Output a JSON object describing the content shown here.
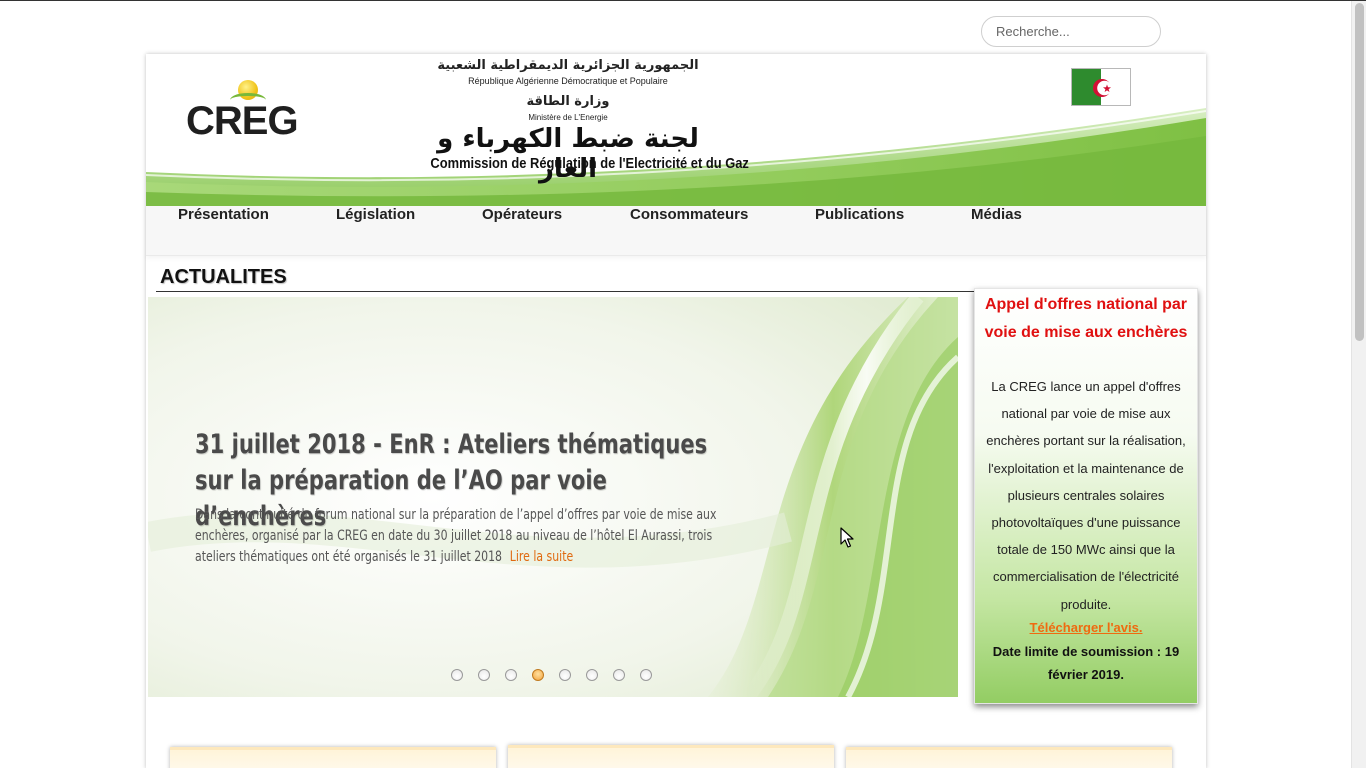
{
  "search": {
    "placeholder": "Recherche..."
  },
  "header": {
    "logo_text": "CREG",
    "arabic_republic": "الجمهورية الجزائرية الديمقراطية الشعبية",
    "french_republic": "République Algérienne Démocratique et Populaire",
    "arabic_ministry": "وزارة الطاقة",
    "french_ministry": "Ministère de L'Energie",
    "arabic_commission": "لجنة ضبط الكهرباء و الغاز",
    "french_commission": "Commission de Régulation de l'Electricité et du Gaz"
  },
  "nav": {
    "items": [
      {
        "label": "Présentation"
      },
      {
        "label": "Législation"
      },
      {
        "label": "Opérateurs"
      },
      {
        "label": "Consommateurs"
      },
      {
        "label": "Publications"
      },
      {
        "label": "Médias"
      }
    ]
  },
  "news": {
    "heading": "ACTUALITES",
    "slide": {
      "title": "31 juillet 2018 - EnR : Ateliers thématiques sur la préparation de l’AO par voie d’enchères",
      "text": "Dans la continuité du forum national sur la préparation de l’appel d’offres par voie de mise aux enchères, organisé par la CREG en date du 30 juillet 2018 au niveau de l’hôtel El Aurassi, trois ateliers thématiques ont été organisés le 31 juillet 2018",
      "read_more": "Lire la suite"
    },
    "slide_count": 8,
    "active_slide": 4
  },
  "side_box": {
    "title": "Appel d'offres national par voie de mise aux enchères",
    "body": "La CREG lance un appel d'offres national par voie de mise aux enchères portant sur la réalisation, l'exploitation et la maintenance de plusieurs centrales solaires photovoltaïques d'une puissance totale de 150 MWc ainsi que la commercialisation de l'électricité produite.",
    "link": "Télécharger l'avis. ",
    "deadline": "Date limite de soumission : 19 février 2019."
  },
  "colors": {
    "accent_green": "#8cc63f",
    "nav_bg": "#f7f7f7",
    "side_title": "#e01010",
    "link_orange": "#ef6a10"
  }
}
